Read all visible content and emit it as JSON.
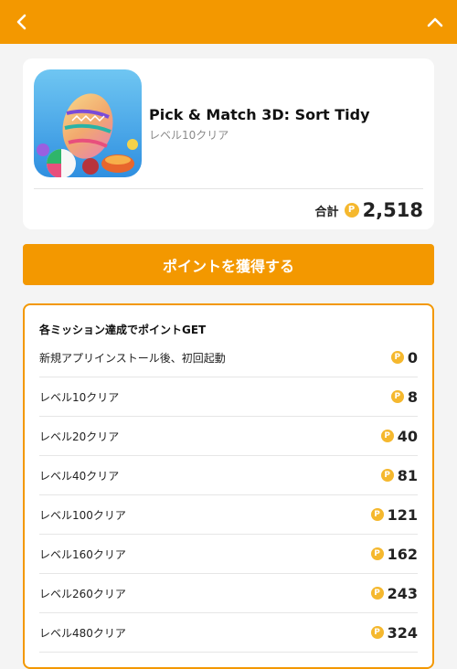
{
  "header": {
    "bg_color": "#f39800",
    "back_icon": "chevron-left-icon",
    "collapse_icon": "chevron-up-icon"
  },
  "app": {
    "icon": "egg-game-app-icon",
    "title": "Pick & Match 3D: Sort Tidy",
    "subtitle": "レベル10クリア",
    "total_label": "合計",
    "coin_symbol": "P",
    "total_points": "2,518"
  },
  "cta": {
    "label": "ポイントを獲得する"
  },
  "missions": {
    "heading": "各ミッション達成でポイントGET",
    "items": [
      {
        "label": "新規アプリインストール後、初回起動",
        "points": "0"
      },
      {
        "label": "レベル10クリア",
        "points": "8"
      },
      {
        "label": "レベル20クリア",
        "points": "40"
      },
      {
        "label": "レベル40クリア",
        "points": "81"
      },
      {
        "label": "レベル100クリア",
        "points": "121"
      },
      {
        "label": "レベル160クリア",
        "points": "162"
      },
      {
        "label": "レベル260クリア",
        "points": "243"
      },
      {
        "label": "レベル480クリア",
        "points": "324"
      }
    ]
  },
  "colors": {
    "accent": "#f39800",
    "coin": "#f5b82e"
  }
}
